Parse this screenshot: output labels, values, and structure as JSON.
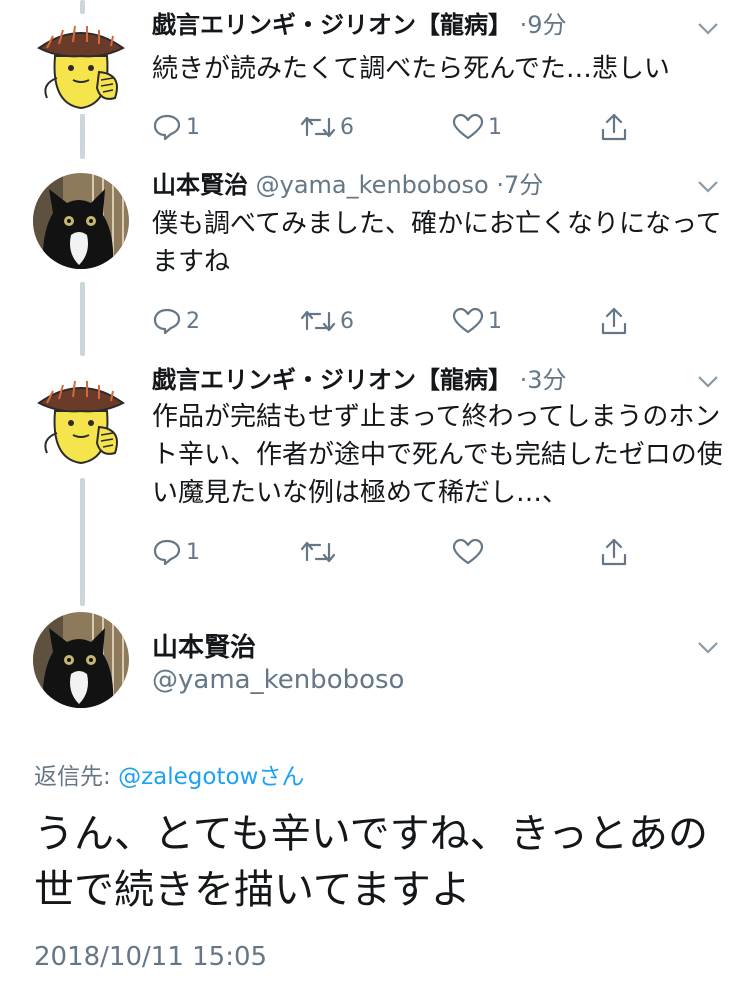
{
  "tweets": [
    {
      "name": "戯言エリンギ・ジリオン【龍病】",
      "handle": "",
      "sep": "·",
      "time": "9分",
      "text": "続きが読みたくて調べたら死んでた…悲しい",
      "reply_count": "1",
      "retweet_count": "6",
      "like_count": "1",
      "avatar": "mushroom-character-icon"
    },
    {
      "name": "山本賢治",
      "handle": "@yama_kenboboso",
      "sep": "·",
      "time": "7分",
      "text": "僕も調べてみました、確かにお亡くなりになってますね",
      "reply_count": "2",
      "retweet_count": "6",
      "like_count": "1",
      "avatar": "black-cat-icon"
    },
    {
      "name": "戯言エリンギ・ジリオン【龍病】",
      "handle": "",
      "sep": "·",
      "time": "3分",
      "text": "作品が完結もせず止まって終わってしまうのホント辛い、作者が途中で死んでも完結したゼロの使い魔見たいな例は極めて稀だし…、",
      "reply_count": "1",
      "retweet_count": "",
      "like_count": "",
      "avatar": "mushroom-character-icon"
    }
  ],
  "main_tweet": {
    "name": "山本賢治",
    "handle": "@yama_kenboboso",
    "reply_to_label": "返信先: ",
    "reply_to_mention": "@zalegotow",
    "reply_to_suffix": "さん",
    "text": "うん、とても辛いですね、きっとあの世で続きを描いてますよ",
    "timestamp": "2018/10/11 15:05",
    "avatar": "black-cat-icon"
  },
  "colors": {
    "accent": "#1da1f2",
    "muted": "#657786",
    "thread_line": "#ccd6dd"
  }
}
